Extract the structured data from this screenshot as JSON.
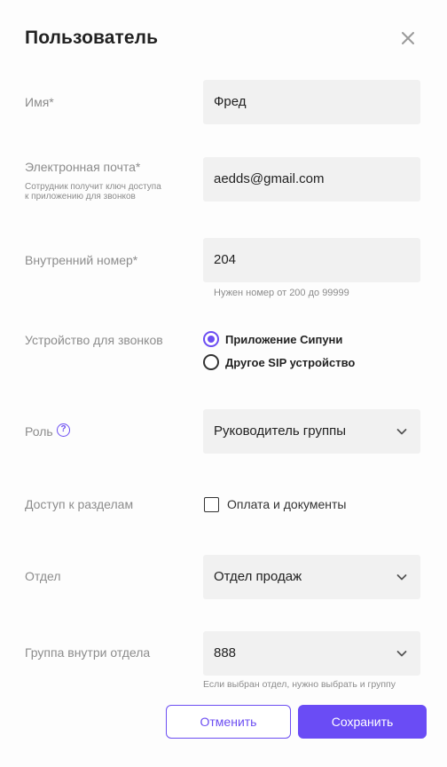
{
  "modal": {
    "title": "Пользователь"
  },
  "fields": {
    "name": {
      "label": "Имя*",
      "value": "Фред"
    },
    "email": {
      "label": "Электронная почта*",
      "sublabel": "Сотрудник получит ключ доступа к приложению для звонков",
      "value": "aedds@gmail.com"
    },
    "extension": {
      "label": "Внутренний номер*",
      "value": "204",
      "hint": "Нужен номер от 200 до 99999"
    },
    "device": {
      "label": "Устройство для звонков",
      "options": [
        {
          "label": "Приложение Сипуни",
          "selected": true
        },
        {
          "label": "Другое SIP устройство",
          "selected": false
        }
      ]
    },
    "role": {
      "label": "Роль",
      "help_icon_glyph": "?",
      "value": "Руководитель группы"
    },
    "access": {
      "label": "Доступ к разделам",
      "checkbox_label": "Оплата и документы",
      "checked": false
    },
    "department": {
      "label": "Отдел",
      "value": "Отдел продаж"
    },
    "group": {
      "label": "Группа внутри отдела",
      "value": "888",
      "hint": "Если выбран отдел, нужно выбрать и группу"
    }
  },
  "buttons": {
    "cancel": "Отменить",
    "save": "Сохранить"
  },
  "colors": {
    "accent": "#6a4cf5",
    "field_bg": "#f1f1f1",
    "label_text": "#8c8c8c"
  },
  "icons": {
    "close": "close-icon",
    "chevron": "chevron-down-icon",
    "help": "help-circle-icon"
  }
}
